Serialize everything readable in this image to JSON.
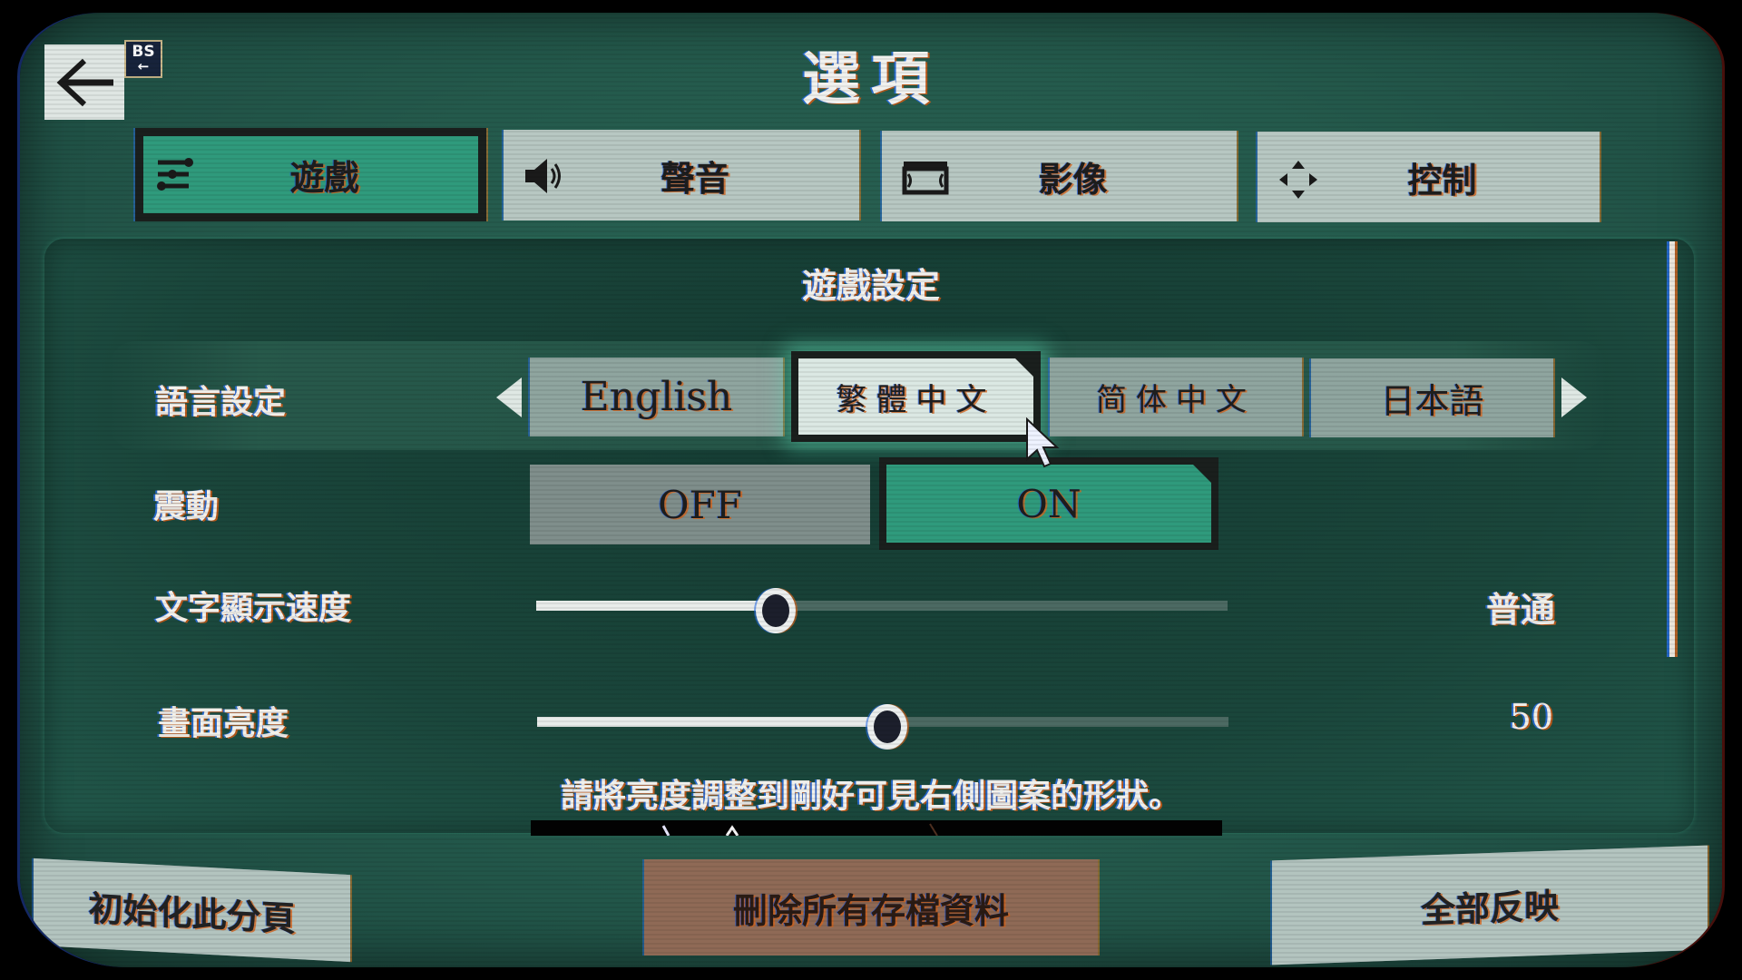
{
  "header": {
    "title": "選項",
    "back_key_label": "BS"
  },
  "tabs": [
    {
      "label": "遊戲",
      "icon": "sliders-icon",
      "active": true
    },
    {
      "label": "聲音",
      "icon": "speaker-icon",
      "active": false
    },
    {
      "label": "影像",
      "icon": "display-icon",
      "active": false
    },
    {
      "label": "控制",
      "icon": "dpad-icon",
      "active": false
    }
  ],
  "section": {
    "title": "遊戲設定"
  },
  "settings": {
    "language": {
      "label": "語言設定",
      "options": [
        "English",
        "繁體中文",
        "简体中文",
        "日本語"
      ],
      "selected": "繁體中文"
    },
    "vibration": {
      "label": "震動",
      "off_label": "OFF",
      "on_label": "ON",
      "value": "ON"
    },
    "text_speed": {
      "label": "文字顯示速度",
      "value_label": "普通",
      "fraction": 0.34
    },
    "brightness": {
      "label": "畫面亮度",
      "value": "50",
      "fraction": 0.5,
      "hint": "請將亮度調整到剛好可見右側圖案的形狀。"
    }
  },
  "footer": {
    "reset_label": "初始化此分頁",
    "delete_label": "刪除所有存檔資料",
    "apply_label": "全部反映"
  },
  "colors": {
    "accent": "#2f9a7c",
    "background": "#245a4c",
    "danger": "#8f6a56",
    "tab_inactive": "#b7c7c2"
  }
}
